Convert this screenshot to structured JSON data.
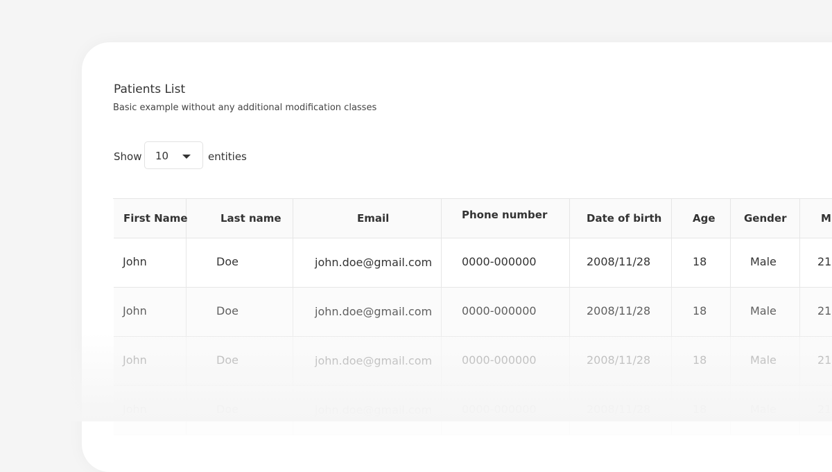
{
  "card": {
    "title": "Patients List",
    "subtitle": "Basic example without any additional modification classes"
  },
  "controls": {
    "show_label": "Show",
    "page_size": "10",
    "entities_label": "entities",
    "dropdown_icon": "caret-down-icon"
  },
  "table": {
    "columns": [
      "First Name",
      "Last name",
      "Email",
      "Phone number",
      "Date of birth",
      "Age",
      "Gender",
      "M"
    ],
    "rows": [
      [
        "John",
        "Doe",
        "john.doe@gmail.com",
        "0000-000000",
        "2008/11/28",
        "18",
        "Male",
        "21"
      ],
      [
        "John",
        "Doe",
        "john.doe@gmail.com",
        "0000-000000",
        "2008/11/28",
        "18",
        "Male",
        "21"
      ],
      [
        "John",
        "Doe",
        "john.doe@gmail.com",
        "0000-000000",
        "2008/11/28",
        "18",
        "Male",
        "21"
      ],
      [
        "John",
        "Doe",
        "john.doe@gmail.com",
        "0000-000000",
        "2008/11/28",
        "18",
        "Male",
        "21"
      ]
    ]
  },
  "colors": {
    "background": "#f5f5f5",
    "card": "#ffffff",
    "border": "#e6e6e6",
    "text": "#333333"
  }
}
